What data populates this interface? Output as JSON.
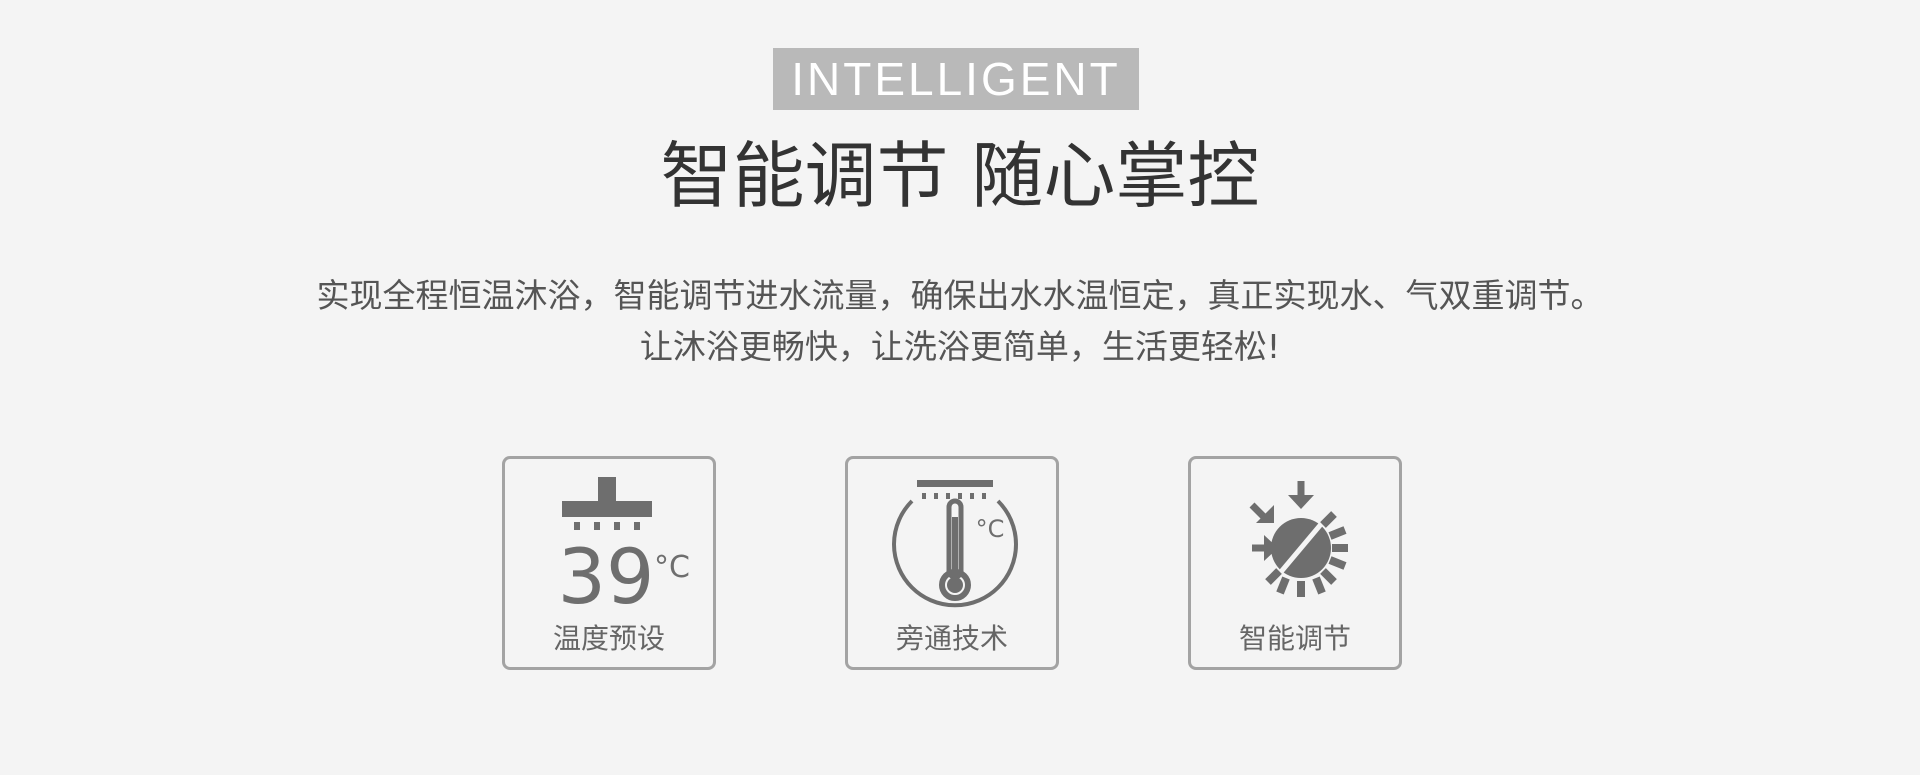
{
  "badge": "INTELLIGENT",
  "heading": "智能调节 随心掌控",
  "description": [
    "实现全程恒温沐浴，智能调节进水流量，确保出水水温恒定，真正实现水、气双重调节。",
    "让沐浴更畅快，让洗浴更简单，生活更轻松!"
  ],
  "features": [
    {
      "label": "温度预设",
      "icon": "shower-temperature-icon",
      "value": "39",
      "unit": "°C"
    },
    {
      "label": "旁通技术",
      "icon": "thermometer-icon",
      "unit": "°C"
    },
    {
      "label": "智能调节",
      "icon": "sun-adjust-icon"
    }
  ],
  "colors": {
    "background": "#f4f4f4",
    "badge_bg": "#b9b9b9",
    "badge_text": "#ffffff",
    "heading": "#333333",
    "text": "#555555",
    "icon": "#6e6e6e",
    "border": "#a3a3a3"
  }
}
